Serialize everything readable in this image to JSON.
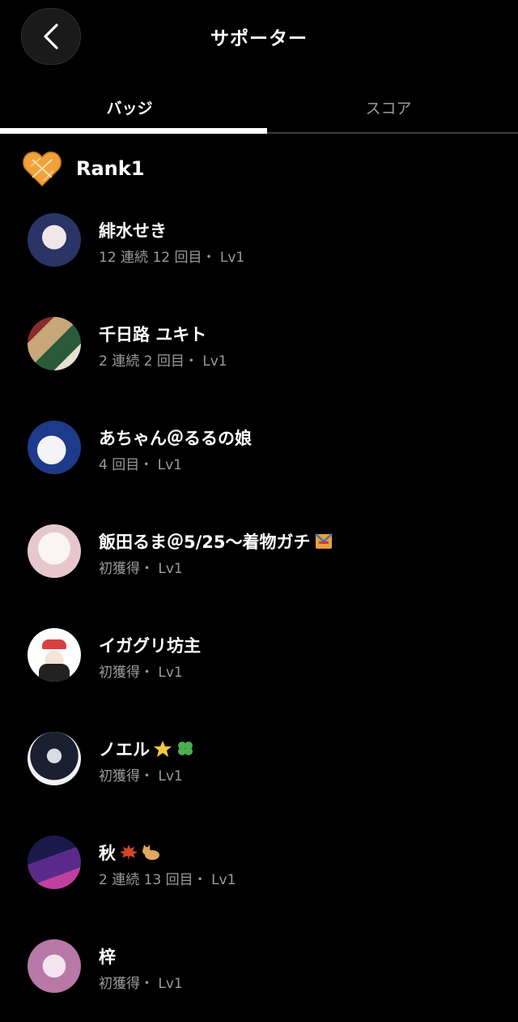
{
  "header": {
    "title": "サポーター",
    "back_icon": "chevron-left-icon"
  },
  "tabs": [
    {
      "label": "バッジ",
      "active": true
    },
    {
      "label": "スコア",
      "active": false
    }
  ],
  "rank": {
    "label": "Rank1",
    "icon": "orange-heart-badge-icon",
    "color": "#f0a23a"
  },
  "supporters": [
    {
      "name": "緋水せき",
      "meta": "12 連続 12 回目・ Lv1",
      "avatar_colors": [
        "#cfd8f0",
        "#2a3466"
      ]
    },
    {
      "name": "千日路 ユキト",
      "meta": "2 連続 2 回目・ Lv1",
      "avatar_colors": [
        "#c8a77a",
        "#7a2a2a"
      ]
    },
    {
      "name": "あちゃん＠るるの娘",
      "meta": "4 回目・ Lv1",
      "avatar_colors": [
        "#e8eef8",
        "#2a4a9a"
      ]
    },
    {
      "name": "飯田るま＠5/25～着物ガチ",
      "meta": "初獲得・ Lv1",
      "avatar_colors": [
        "#f5eef0",
        "#e8c8cc"
      ]
    },
    {
      "name": "イガグリ坊主",
      "meta": "初獲得・ Lv1",
      "avatar_colors": [
        "#f4f4f4",
        "#d84040"
      ]
    },
    {
      "name": "ノエル",
      "meta": "初獲得・ Lv1",
      "avatar_colors": [
        "#e8e8ec",
        "#1a2030"
      ]
    },
    {
      "name": "秋",
      "meta": "2 連続 13 回目・ Lv1",
      "avatar_colors": [
        "#2a2a6a",
        "#c040a0"
      ]
    },
    {
      "name": "梓",
      "meta": "初獲得・ Lv1",
      "avatar_colors": [
        "#d8a8c8",
        "#8a5a8a"
      ]
    }
  ],
  "emojis": {
    "kimono": "kimono-emoji-icon",
    "star": "glowing-star-emoji-icon",
    "clover": "four-leaf-clover-emoji-icon",
    "maple": "maple-leaf-emoji-icon",
    "cat": "cat-emoji-icon"
  }
}
